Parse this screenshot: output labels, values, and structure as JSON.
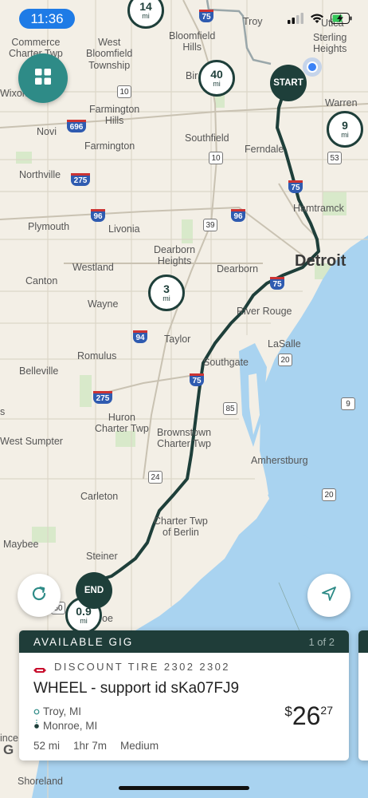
{
  "status_bar": {
    "time": "11:36"
  },
  "map": {
    "labels": {
      "troy": "Troy",
      "commerce": "Commerce\nCharter Twp",
      "west_bloomfield": "West\nBloomfield\nTownship",
      "bloomfield_hills": "Bloomfield\nHills",
      "sterling_heights": "Sterling\nHeights",
      "utica": "Utica",
      "birmingham": "Bir  ham",
      "wixom": "Wixom",
      "warren": "Warren",
      "farmington_hills": "Farmington\nHills",
      "novi": "Novi",
      "farmington": "Farmington",
      "southfield": "Southfield",
      "ferndale": "Ferndale",
      "northville": "Northville",
      "hamtramck": "Hamtramck",
      "plymouth": "Plymouth",
      "livonia": "Livonia",
      "detroit": "Detroit",
      "dearborn_heights": "Dearborn\nHeights",
      "westland": "Westland",
      "dearborn": "Dearborn",
      "canton": "Canton",
      "wayne": "Wayne",
      "river_rouge": "River Rouge",
      "taylor": "Taylor",
      "lasalle": "LaSalle",
      "romulus": "Romulus",
      "southgate": "Southgate",
      "belleville": "Belleville",
      "huron": "Huron\nCharter Twp",
      "brownstown": "Brownstown\nCharter Twp",
      "west_sumpter": "West Sumpter",
      "amherstburg": "Amherstburg",
      "carleton": "Carleton",
      "berlin": "Charter Twp\nof Berlin",
      "maybee": "Maybee",
      "steiner": "Steiner",
      "monroe_frag": "oe",
      "shoreland": "Shoreland",
      "ince": "ince",
      "s_frag": "s"
    },
    "road_shields": {
      "i75_top": "75",
      "m10_a": "10",
      "i696": "696",
      "m10_b": "10",
      "m53": "53",
      "i275_a": "275",
      "i96_a": "96",
      "m39": "39",
      "i96_b": "96",
      "i75_mid": "75",
      "i75_c": "75",
      "i94": "94",
      "m20_a": "20",
      "i75_d": "75",
      "m85": "85",
      "i275_b": "275",
      "m9": "9",
      "m24": "24",
      "m20_b": "20",
      "m50": "50"
    },
    "route_markers": [
      {
        "value": "14",
        "unit": "mi"
      },
      {
        "value": "40",
        "unit": "mi"
      },
      {
        "value": "9",
        "unit": "mi"
      },
      {
        "value": "3",
        "unit": "mi"
      },
      {
        "value": "0.9",
        "unit": "mi"
      }
    ],
    "start_label": "START",
    "end_label": "END",
    "google_mark": "G"
  },
  "gig_card": {
    "header": "AVAILABLE GIG",
    "pager": "1 of 2",
    "store": "DISCOUNT TIRE 2302 2302",
    "title": "WHEEL - support id sKa07FJ9",
    "origin": "Troy, MI",
    "destination": "Monroe, MI",
    "price_currency": "$",
    "price_dollars": "26",
    "price_cents": "27",
    "distance": "52 mi",
    "duration": "1hr 7m",
    "difficulty": "Medium"
  },
  "colors": {
    "route": "#1e3f3a",
    "accent": "#2e8b87",
    "card_header": "#1f3d39",
    "water": "#a9d3f0",
    "land": "#f3efe6",
    "location_dot": "#3b82f6"
  }
}
